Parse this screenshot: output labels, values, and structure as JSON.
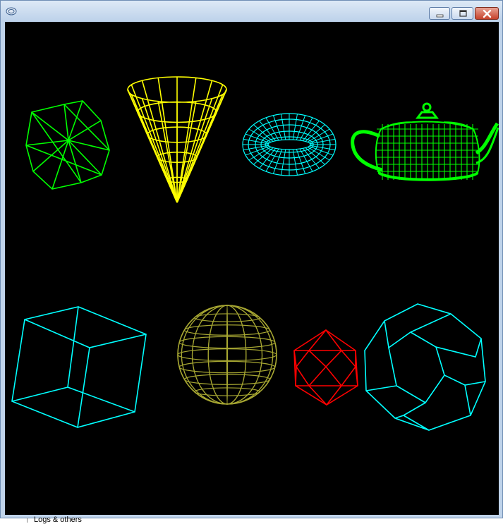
{
  "window": {
    "title": "",
    "icon": "app-icon",
    "controls": {
      "minimize": "minimize-icon",
      "maximize": "maximize-icon",
      "close": "close-icon"
    }
  },
  "scene": {
    "background": "#000000",
    "shapes": [
      {
        "name": "green-octahedron-wireframe",
        "shape": "octahedron",
        "color": "#00ff00"
      },
      {
        "name": "yellow-cone-wireframe",
        "shape": "cone",
        "color": "#ffff00"
      },
      {
        "name": "cyan-torus-wireframe",
        "shape": "torus",
        "color": "#00ffff"
      },
      {
        "name": "green-teapot-wireframe",
        "shape": "teapot",
        "color": "#00ff00"
      },
      {
        "name": "cyan-cube-wireframe",
        "shape": "cube",
        "color": "#00ffff"
      },
      {
        "name": "olive-sphere-wireframe",
        "shape": "sphere",
        "color": "#a6a632"
      },
      {
        "name": "red-icosahedron-wireframe",
        "shape": "icosahedron",
        "color": "#ff0000"
      },
      {
        "name": "cyan-dodecahedron-wireframe",
        "shape": "dodecahedron",
        "color": "#00ffff"
      }
    ]
  },
  "statusbar": {
    "text": "Logs & others"
  }
}
